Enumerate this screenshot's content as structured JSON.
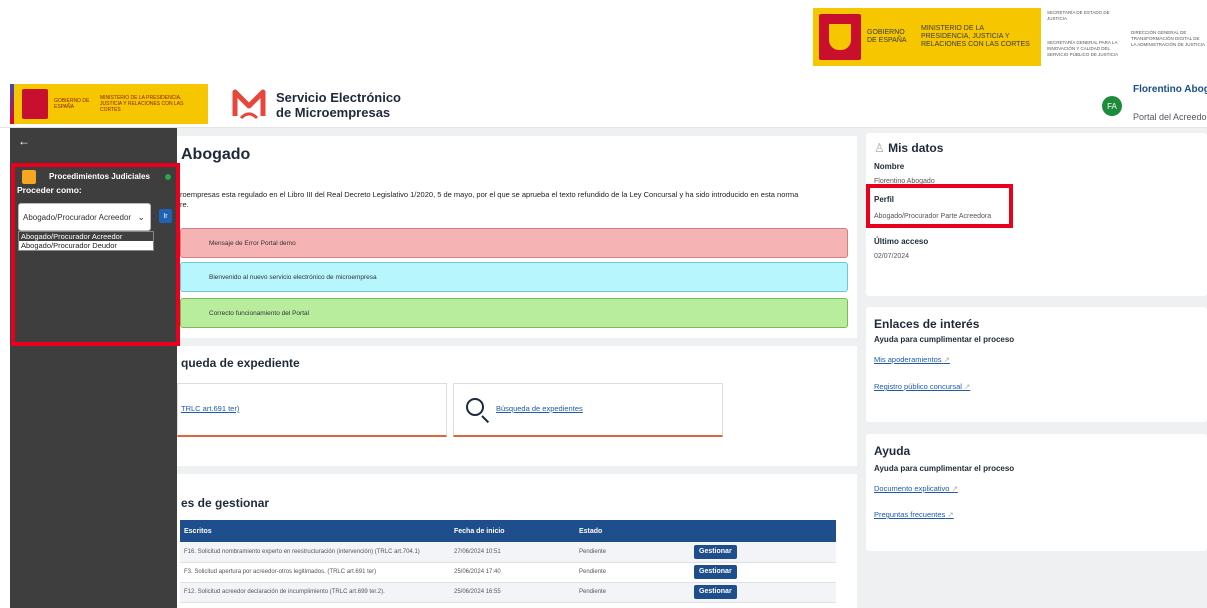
{
  "gov_banner": {
    "gobierno": "GOBIERNO DE ESPAÑA",
    "ministerio": "MINISTERIO DE LA PRESIDENCIA, JUSTICIA Y RELACIONES CON LAS CORTES",
    "secretaria_estado": "SECRETARÍA DE ESTADO DE JUSTICIA",
    "secretaria_general": "SECRETARÍA GENERAL PARA LA INNOVACIÓN Y CALIDAD DEL SERVICIO PÚBLICO DE JUSTICIA",
    "direccion_general": "DIRECCIÓN GENERAL DE TRANSFORMACIÓN DIGITAL DE LA ADMINISTRACIÓN DE JUSTICIA"
  },
  "header": {
    "gob_text": "GOBIERNO DE ESPAÑA",
    "min_text": "MINISTERIO DE LA PRESIDENCIA, JUSTICIA Y RELACIONES CON LAS CORTES",
    "app_title_line1": "Servicio Electrónico",
    "app_title_line2": "de Microempresas",
    "user_initials": "FA",
    "user_name": "Florentino Abogad",
    "user_role": "Portal del Acreedor"
  },
  "sidebar": {
    "back_icon": "←",
    "procedure_title": "Procedimientos Judiciales",
    "proceed_label": "Proceder como:",
    "selected_role": "Abogado/Procurador Acreedor",
    "go_button": "Ir",
    "options": [
      "Abogado/Procurador Acreedor",
      "Abogado/Procurador Deudor"
    ]
  },
  "main": {
    "page_title": "Abogado",
    "intro": "roempresas esta regulado en el Libro III del Real Decreto Legislativo 1/2020, 5 de mayo, por el que se aprueba el texto refundido de la Ley Concursal y ha sido introducido en esta norma",
    "intro_line2": "re.",
    "alert_error": "Mensaje de Error Portal demo",
    "alert_info": "Bienvenido al nuevo servicio electrónico de microempresa",
    "alert_success": "Correcto funcionamiento del Portal",
    "search_title": "queda de expediente",
    "search_card1_link": "TRLC art.691 ter)",
    "search_card2_link": "Búsqueda de expedientes",
    "pending_title": "es de gestionar",
    "table": {
      "headers": [
        "Escritos",
        "Fecha de inicio",
        "Estado",
        ""
      ],
      "rows": [
        {
          "escrito": "F16. Solicitud nombramiento experto en reestructuración (intervención) (TRLC art.704.1)",
          "fecha": "27/06/2024 10:51",
          "estado": "Pendiente",
          "accion": "Gestionar"
        },
        {
          "escrito": "F3. Solicitud apertura por acreedor-otros legitimados. (TRLC art.691 ter)",
          "fecha": "25/06/2024 17:40",
          "estado": "Pendiente",
          "accion": "Gestionar"
        },
        {
          "escrito": "F12. Solicitud acreedor declaración de incumplimiento (TRLC art.699 ter.2).",
          "fecha": "25/06/2024 16:55",
          "estado": "Pendiente",
          "accion": "Gestionar"
        }
      ]
    }
  },
  "mis_datos": {
    "title": "Mis datos",
    "nombre_label": "Nombre",
    "nombre_value": "Florentino Abogado",
    "perfil_label": "Perfil",
    "perfil_value": "Abogado/Procurador Parte Acreedora",
    "acceso_label": "Último acceso",
    "acceso_value": "02/07/2024"
  },
  "enlaces": {
    "title": "Enlaces de interés",
    "subtitle": "Ayuda para cumplimentar el proceso",
    "link1": "Mis apoderamientos",
    "link2": "Registro público concursal"
  },
  "ayuda": {
    "title": "Ayuda",
    "subtitle": "Ayuda para cumplimentar el proceso",
    "link1": "Documento explicativo",
    "link2": "Preguntas frecuentes"
  },
  "colors": {
    "accent": "#1f4e8c",
    "highlight": "#e8001c",
    "gov_yellow": "#f6c700",
    "sidebar": "#3e3e3e"
  }
}
